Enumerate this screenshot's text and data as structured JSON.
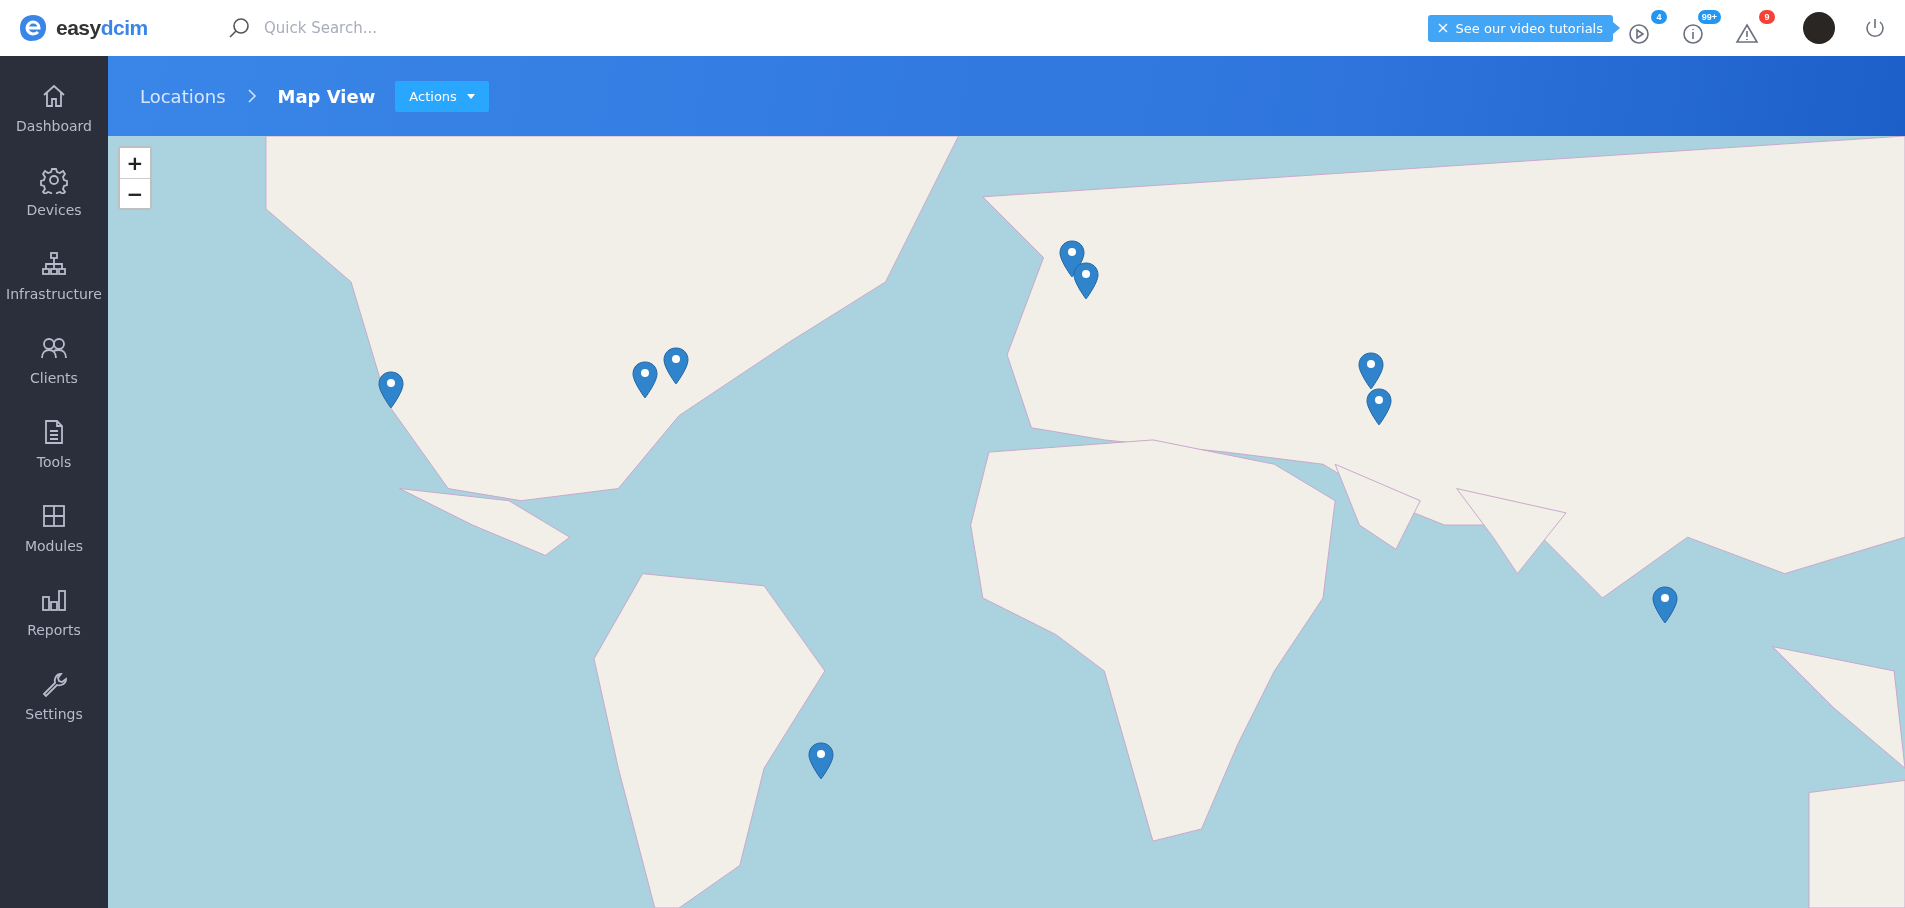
{
  "topbar": {
    "logo": {
      "text": "easy",
      "accent_text": "dcim"
    },
    "search": {
      "placeholder": "Quick Search..."
    },
    "tutorial_tip": {
      "label": "See our video tutorials"
    },
    "notifications": [
      {
        "kind": "video",
        "count": "4",
        "color": "#2196f3"
      },
      {
        "kind": "info",
        "count": "99+",
        "color": "#2196f3"
      },
      {
        "kind": "alert",
        "count": "9",
        "color": "#f44336"
      }
    ]
  },
  "sidebar": {
    "items": [
      {
        "kind": "home",
        "label": "Dashboard",
        "selected": false
      },
      {
        "kind": "gear",
        "label": "Devices",
        "selected": false
      },
      {
        "kind": "hierarchy",
        "label": "Infrastructure",
        "selected": false
      },
      {
        "kind": "people",
        "label": "Clients",
        "selected": false
      },
      {
        "kind": "document",
        "label": "Tools",
        "selected": false
      },
      {
        "kind": "grid",
        "label": "Modules",
        "selected": false
      },
      {
        "kind": "chart",
        "label": "Reports",
        "selected": false
      },
      {
        "kind": "wrench",
        "label": "Settings",
        "selected": false
      }
    ]
  },
  "breadcrumb": [
    "Locations",
    "Map View"
  ],
  "actions_button": {
    "label": "Actions"
  },
  "map": {
    "zoom_in": "+",
    "zoom_out": "−"
  }
}
